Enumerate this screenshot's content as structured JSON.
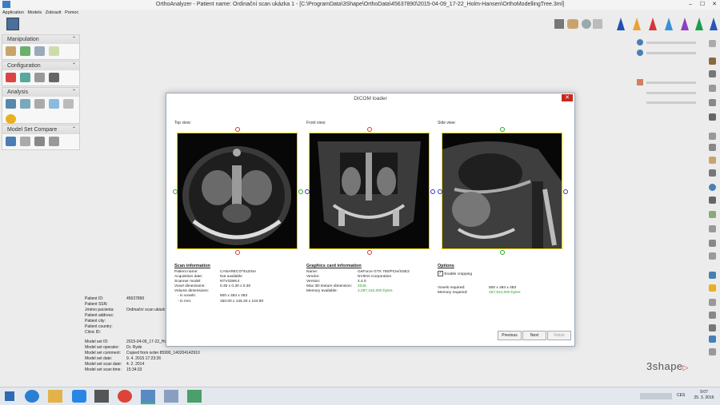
{
  "window": {
    "title": "OrthoAnalyzer - Patient name:  Ordinační scan ukázka 1 - [C:\\ProgramData\\3Shape\\OrthoData\\45637890\\2015-04-09_17-22_Holm-Hansen\\OrthoModellingTree.3ml]",
    "minimize": "–",
    "maximize": "☐",
    "close": "✕"
  },
  "menu": [
    "Application",
    "Models",
    "Zobrazit",
    "Pomoc"
  ],
  "panels": [
    {
      "title": "Manipulation"
    },
    {
      "title": "Configuration"
    },
    {
      "title": "Analysis"
    },
    {
      "title": "Model Set Compare"
    }
  ],
  "patient": {
    "labels": [
      "Patient ID:",
      "Patient SSN:",
      "Jméno pacienta:",
      "Patient address:",
      "Patient city:",
      "Patient country:",
      "Clinic ID:"
    ],
    "values": [
      "45637890",
      "",
      "Ordinační scan ukázk",
      "",
      "",
      "",
      ""
    ],
    "model_labels": [
      "Model set ID:",
      "Model set operator:",
      "Model set comment:",
      "Model set date:",
      "Model set scan date:",
      "Model set scan time:"
    ],
    "model_values": [
      "2015-04-09_17-22_Holm-Hansen",
      "Dr. Ryde",
      "Copied from order 85990_140204142910",
      "9. 4. 2015 17:23:36",
      "4. 2. 2014",
      "15:34:33"
    ]
  },
  "dialog": {
    "title": "DICOM loader",
    "close": "✕",
    "views": [
      "Top view:",
      "Front view:",
      "Side view:"
    ],
    "scan_info": {
      "heading": "Scan information",
      "labels": [
        "Patient name:",
        "Acquisition date:",
        "Scanner model:",
        "Voxel dimensions:",
        "Volume dimensions:",
        "- in voxels:",
        "- in mm:"
      ],
      "values": [
        "CANARECO^ELENA",
        "Not available",
        "NTVGiMK4",
        "0.30 x 0.30 x 0.30",
        "",
        "500 x 484 x 483",
        "150.00 x 145.20 x 144.90"
      ]
    },
    "graphics_info": {
      "heading": "Graphics card information",
      "labels": [
        "Name:",
        "Vendor:",
        "Version:",
        "Max 3D texture dimension:",
        "Memory available:"
      ],
      "values": [
        "GeForce GTX 760/PCIe/SSE2",
        "NVIDIA Corporation",
        "4.4.0",
        "2048",
        "2,097,152,000 bytes"
      ]
    },
    "options": {
      "heading": "Options",
      "crop_label": "Enable cropping",
      "crop_checked": true,
      "labels": [
        "Voxels required:",
        "Memory required:"
      ],
      "values": [
        "500 x 484 x 483",
        "467,544,000 bytes"
      ]
    },
    "buttons": {
      "previous": "Previous",
      "next": "Next",
      "finish": "Finish"
    }
  },
  "brand": "3shape",
  "taskbar": {
    "clock_time": "9:07",
    "clock_date": "25. 3. 2016",
    "lang": "CES"
  },
  "colors": {
    "accent": "#e6d200",
    "close": "#c42b1c",
    "green": "#2a9d2a",
    "brand": "#d9362b"
  }
}
